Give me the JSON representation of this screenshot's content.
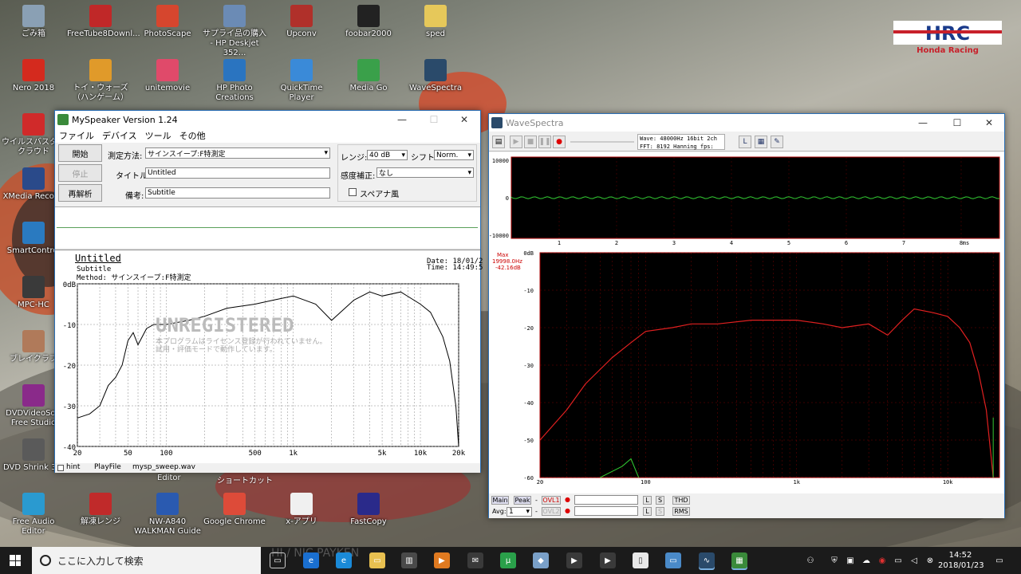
{
  "desktop_icons": [
    {
      "label": "ごみ箱",
      "icon": "recycle-bin-icon",
      "color": "#8aa0b4"
    },
    {
      "label": "FreeTube8Downl...",
      "icon": "freetube-icon",
      "color": "#c02828"
    },
    {
      "label": "PhotoScape",
      "icon": "photoscape-icon",
      "color": "#d6462e"
    },
    {
      "label": "サプライ品の購入 - HP Deskjet 352...",
      "icon": "hp-printer-icon",
      "color": "#6b8bb5"
    },
    {
      "label": "Upconv",
      "icon": "upconv-icon",
      "color": "#b0302a"
    },
    {
      "label": "foobar2000",
      "icon": "foobar-icon",
      "color": "#222222"
    },
    {
      "label": "sped",
      "icon": "folder-icon",
      "color": "#e6c85a"
    },
    {
      "label": "Nero 2018",
      "icon": "nero-icon",
      "color": "#d42a1e"
    },
    {
      "label": "トイ・ウォーズ（ハンゲーム）",
      "icon": "toywars-icon",
      "color": "#e09a2a"
    },
    {
      "label": "unitemovie",
      "icon": "unitemovie-icon",
      "color": "#e04a6a"
    },
    {
      "label": "HP Photo Creations",
      "icon": "hp-photo-icon",
      "color": "#2a74c0"
    },
    {
      "label": "QuickTime Player",
      "icon": "quicktime-icon",
      "color": "#3a8ad8"
    },
    {
      "label": "Media Go",
      "icon": "mediago-icon",
      "color": "#3aa04a"
    },
    {
      "label": "WaveSpectra",
      "icon": "wavespectra-icon",
      "color": "#2a4a6a"
    },
    {
      "label": "ウイルスバスター クラウド",
      "icon": "virusbuster-icon",
      "color": "#d02a2a"
    },
    {
      "label": "XMedia Recode",
      "icon": "xmedia-icon",
      "color": "#2a4a8a"
    },
    {
      "label": "SmartControl",
      "icon": "smartcontrol-icon",
      "color": "#2a7ac0"
    },
    {
      "label": "MPC-HC",
      "icon": "mpc-icon",
      "color": "#3a3a3a"
    },
    {
      "label": "ブレイクラブ",
      "icon": "breaklove-icon",
      "color": "#b07a5a"
    },
    {
      "label": "DVDVideoSoft Free Studio",
      "icon": "dvdvideosoft-icon",
      "color": "#8a2a8a"
    },
    {
      "label": "DVD Shrink 3.2",
      "icon": "dvdshrink-icon",
      "color": "#5a5a5a"
    },
    {
      "label": "Free Audio Editor",
      "icon": "free-audio-editor-icon",
      "color": "#2a9ad0"
    },
    {
      "label": "解凍レンジ",
      "icon": "kaitou-range-icon",
      "color": "#c02a2a"
    },
    {
      "label": "NW-A840 WALKMAN Guide",
      "icon": "walkman-icon",
      "color": "#2a5ab0"
    },
    {
      "label": "Google Chrome",
      "icon": "chrome-icon",
      "color": "#dd4b39"
    },
    {
      "label": "x-アプリ",
      "icon": "x-app-icon",
      "color": "#f0f0f0"
    },
    {
      "label": "FastCopy",
      "icon": "fastcopy-icon",
      "color": "#2a2a8a"
    }
  ],
  "behind_labels": {
    "editor": "Editor",
    "shortcut": "ショートカット"
  },
  "myspeaker": {
    "title": "MySpeaker Version 1.24",
    "menu": [
      "ファイル",
      "デバイス",
      "ツール",
      "その他"
    ],
    "buttons": {
      "start": "開始",
      "stop": "停止",
      "reanalyze": "再解析"
    },
    "labels": {
      "method": "測定方法:",
      "title": "タイトル:",
      "note": "備考:",
      "range": "レンジ:",
      "shift": "シフト:",
      "correction": "感度補正:",
      "spectrum": "スペアナ風"
    },
    "values": {
      "method": "サインスイープ:F特測定",
      "title": "Untitled",
      "note": "Subtitle",
      "range": "40 dB",
      "shift": "Norm.",
      "correction": "なし"
    },
    "report": {
      "title": "Untitled",
      "subtitle": "Subtitle",
      "method": "Method: サインスイープ:F特測定",
      "date": "Date: 18/01/2",
      "time": "Time: 14:49:5",
      "watermark": "UNREGISTERED",
      "wm1": "本プログラムはライセンス登録が行われていません。",
      "wm2": "試用・評価モードで動作しています。"
    },
    "status": {
      "hint": "hint",
      "playfile_label": "PlayFile",
      "playfile": "mysp_sweep.wav"
    }
  },
  "chart_data": [
    {
      "type": "line",
      "name": "myspeaker-frequency-response",
      "ylabels": [
        "0dB",
        "-10",
        "-20",
        "-30",
        "-40"
      ],
      "ylim": [
        -40,
        0
      ],
      "xlabels": [
        "20",
        "50",
        "100",
        "500",
        "1k",
        "5k",
        "10k",
        "20k"
      ],
      "xlim": [
        20,
        20000
      ],
      "xscale": "log",
      "x": [
        20,
        25,
        30,
        35,
        40,
        45,
        50,
        55,
        60,
        70,
        80,
        100,
        150,
        200,
        300,
        500,
        700,
        1000,
        1500,
        2000,
        3000,
        4000,
        5000,
        7000,
        10000,
        12000,
        15000,
        17000,
        19000,
        20000
      ],
      "y": [
        -33,
        -32,
        -30,
        -25,
        -23,
        -20,
        -14,
        -12,
        -15,
        -11,
        -10,
        -10,
        -9,
        -8,
        -6,
        -5,
        -4,
        -3,
        -5,
        -9,
        -4,
        -2,
        -3,
        -2,
        -5,
        -7,
        -13,
        -19,
        -30,
        -40
      ]
    },
    {
      "type": "line",
      "name": "wavespectra-waveform",
      "ylabels": [
        "10000",
        "0",
        "-10000"
      ],
      "xlabels": [
        "1",
        "2",
        "3",
        "4",
        "5",
        "6",
        "7",
        "ms",
        "8"
      ]
    },
    {
      "type": "line",
      "name": "wavespectra-spectrum",
      "xscale": "log",
      "ylabels": [
        "0dB",
        "-10",
        "-20",
        "-30",
        "-40",
        "-50",
        "-60"
      ],
      "ylim": [
        -60,
        0
      ],
      "xlabels": [
        "20",
        "100",
        "1k",
        "10k"
      ],
      "xlim": [
        20,
        22000
      ],
      "x": [
        20,
        30,
        40,
        60,
        80,
        100,
        150,
        200,
        300,
        500,
        1000,
        1500,
        2000,
        3000,
        4000,
        5000,
        6000,
        8000,
        10000,
        12000,
        14000,
        16000,
        18000,
        20000
      ],
      "y": [
        -50,
        -42,
        -35,
        -28,
        -24,
        -21,
        -20,
        -19,
        -19,
        -18,
        -18,
        -19,
        -20,
        -19,
        -22,
        -18,
        -15,
        -16,
        -17,
        -20,
        -24,
        -32,
        -42,
        -60
      ],
      "peak": {
        "x": [
          50,
          70,
          80,
          90
        ],
        "y": [
          -60,
          -57,
          -55,
          -60
        ]
      },
      "readout": {
        "max": "Max",
        "freq": "19998.0Hz",
        "level": "-42.16dB"
      }
    }
  ],
  "wavespectra": {
    "title": "WaveSpectra",
    "info1": "Wave: 48000Hz  16bit  2ch",
    "info2": "FFT:  8192  Hanning     fps:",
    "bottom": {
      "main": "Main",
      "peak": "Peak",
      "ovl1": "OVL1",
      "ovl2": "OVL2",
      "avg": "Avg:",
      "avg_val": "1",
      "l": "L",
      "s": "S",
      "thd": "THD",
      "rms": "RMS",
      "dash": "-"
    }
  },
  "taskbar": {
    "search": "ここに入力して検索",
    "time": "14:52",
    "date": "2018/01/23",
    "watermark": "HI / NIC  PAYKEN"
  }
}
